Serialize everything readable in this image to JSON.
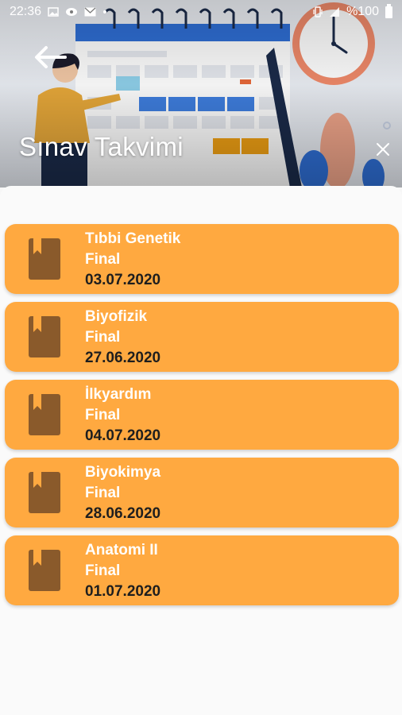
{
  "status_bar": {
    "time": "22:36",
    "battery": "%100",
    "icons": [
      "image-icon",
      "media-icon",
      "mail-icon",
      "dot-icon",
      "vibrate-icon",
      "signal-icon",
      "battery-icon"
    ]
  },
  "header": {
    "title": "Sınav Takvimi",
    "back_icon": "arrow-left-icon",
    "close_icon": "close-icon"
  },
  "exams": [
    {
      "name": "Tıbbi Genetik",
      "type": "Final",
      "date": "03.07.2020"
    },
    {
      "name": "Biyofizik",
      "type": "Final",
      "date": "27.06.2020"
    },
    {
      "name": "İlkyardım",
      "type": "Final",
      "date": "04.07.2020"
    },
    {
      "name": "Biyokimya",
      "type": "Final",
      "date": "28.06.2020"
    },
    {
      "name": "Anatomi II",
      "type": "Final",
      "date": "01.07.2020"
    }
  ],
  "colors": {
    "card": "#ffa940",
    "card_icon": "#8a5a2b",
    "date_text": "#1e1e1e",
    "title_text": "#ffffff"
  }
}
